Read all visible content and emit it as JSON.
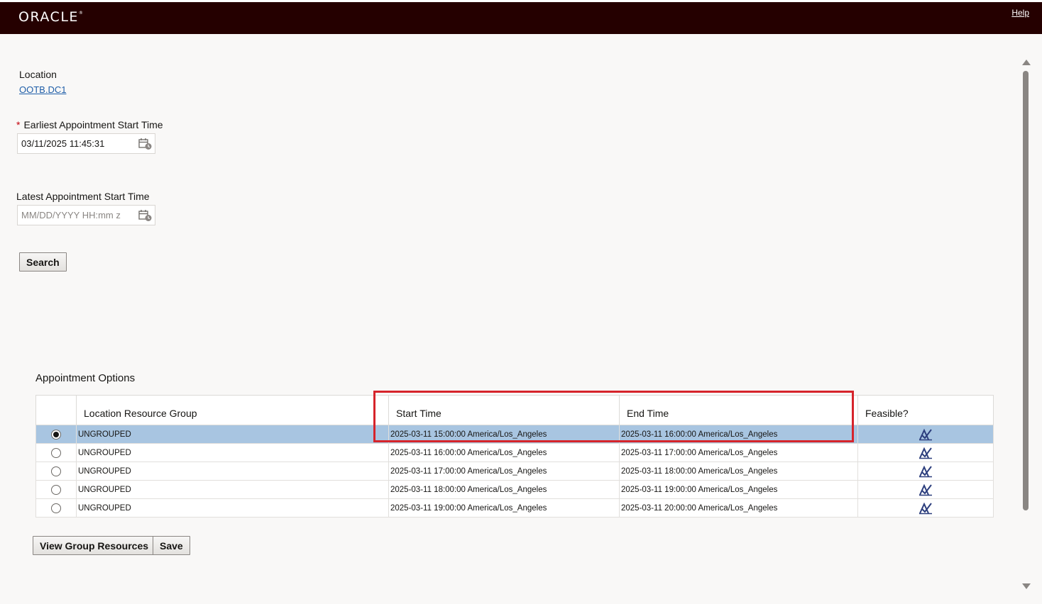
{
  "header": {
    "logo_text": "ORACLE",
    "help_label": "Help"
  },
  "location": {
    "label": "Location",
    "value": "OOTB.DC1"
  },
  "earliest": {
    "required_mark": "*",
    "label": "Earliest Appointment Start Time",
    "value": "03/11/2025 11:45:31"
  },
  "latest": {
    "label": "Latest Appointment Start Time",
    "placeholder": "MM/DD/YYYY HH:mm z"
  },
  "search_label": "Search",
  "appointment_options": {
    "title": "Appointment Options",
    "columns": [
      "Location Resource Group",
      "Start Time",
      "End Time",
      "Feasible?"
    ],
    "rows": [
      {
        "group": "UNGROUPED",
        "start": "2025-03-11 15:00:00 America/Los_Angeles",
        "end": "2025-03-11 16:00:00 America/Los_Angeles",
        "selected": true
      },
      {
        "group": "UNGROUPED",
        "start": "2025-03-11 16:00:00 America/Los_Angeles",
        "end": "2025-03-11 17:00:00 America/Los_Angeles",
        "selected": false
      },
      {
        "group": "UNGROUPED",
        "start": "2025-03-11 17:00:00 America/Los_Angeles",
        "end": "2025-03-11 18:00:00 America/Los_Angeles",
        "selected": false
      },
      {
        "group": "UNGROUPED",
        "start": "2025-03-11 18:00:00 America/Los_Angeles",
        "end": "2025-03-11 19:00:00 America/Los_Angeles",
        "selected": false
      },
      {
        "group": "UNGROUPED",
        "start": "2025-03-11 19:00:00 America/Los_Angeles",
        "end": "2025-03-11 20:00:00 America/Los_Angeles",
        "selected": false
      }
    ]
  },
  "buttons": {
    "view_group_resources": "View Group Resources",
    "save": "Save"
  },
  "icons": {
    "date_picker": "calendar-clock-icon",
    "feasible": "infeasible-check-icon"
  },
  "colors": {
    "header_bg": "#250000",
    "selected_row": "#a8c5e1",
    "highlight_box": "#d6242b",
    "link": "#1f5ea8"
  }
}
